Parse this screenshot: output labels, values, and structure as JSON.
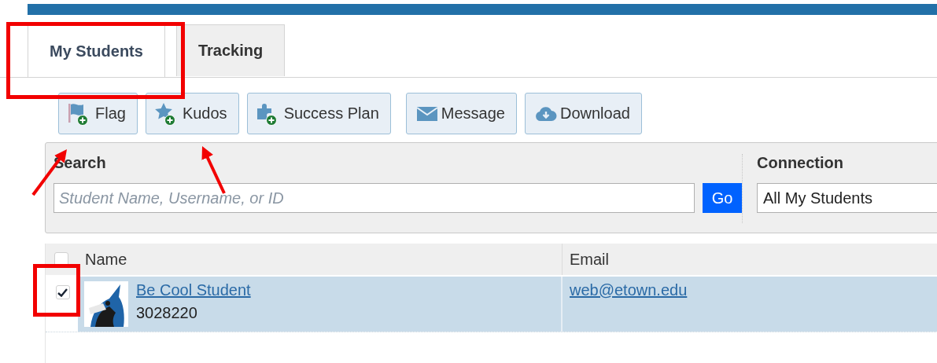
{
  "tabs": [
    {
      "label": "My Students",
      "selected": true
    },
    {
      "label": "Tracking",
      "selected": false
    }
  ],
  "toolbar": [
    {
      "label": "Flag",
      "kind": "flag",
      "add": true
    },
    {
      "label": "Kudos",
      "kind": "star",
      "add": true
    },
    {
      "label": "Success Plan",
      "kind": "puzzle",
      "add": true
    },
    {
      "label": "Message",
      "kind": "envelope",
      "add": false
    },
    {
      "label": "Download",
      "kind": "cloud",
      "add": false
    }
  ],
  "search": {
    "label": "Search",
    "placeholder": "Student Name, Username, or ID",
    "button": "Go"
  },
  "connection": {
    "label": "Connection",
    "value": "All My Students"
  },
  "table": {
    "select_all": {
      "checked": false
    },
    "columns": [
      "Name",
      "Email"
    ],
    "rows": [
      {
        "checked": true,
        "selected": true,
        "name": "Be Cool Student",
        "id": "3028220",
        "email": "web@etown.edu"
      }
    ]
  },
  "annotations": [
    {
      "kind": "box"
    },
    {
      "kind": "arrow"
    },
    {
      "kind": "arrow"
    },
    {
      "kind": "box"
    }
  ]
}
